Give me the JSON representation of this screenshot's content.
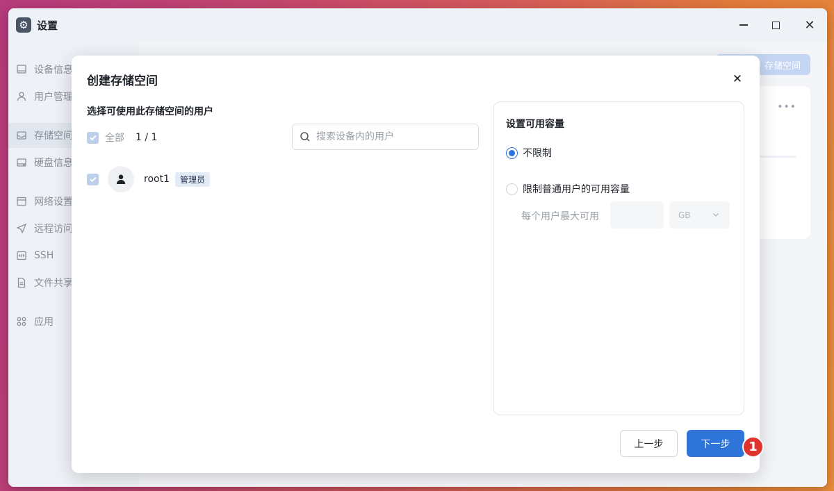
{
  "window": {
    "title": "设置"
  },
  "sidebar": {
    "items": [
      {
        "label": "设备信息"
      },
      {
        "label": "用户管理"
      },
      {
        "label": "存储空间"
      },
      {
        "label": "硬盘信息"
      },
      {
        "label": "网络设置"
      },
      {
        "label": "远程访问"
      },
      {
        "label": "SSH"
      },
      {
        "label": "文件共享"
      },
      {
        "label": "应用"
      }
    ]
  },
  "background": {
    "create_button_label": "存储空间"
  },
  "modal": {
    "title": "创建存储空间",
    "section_title": "选择可使用此存储空间的用户",
    "select_all_label": "全部",
    "selection_count": "1 / 1",
    "search_placeholder": "搜索设备内的用户",
    "users": [
      {
        "name": "root1",
        "role_badge": "管理员"
      }
    ],
    "capacity": {
      "title": "设置可用容量",
      "option_unlimited": "不限制",
      "option_limited": "限制普通用户的可用容量",
      "per_user_label": "每个用户最大可用",
      "unit": "GB"
    },
    "prev_button": "上一步",
    "next_button": "下一步"
  },
  "annotation": {
    "step_number": "1"
  },
  "colors": {
    "accent": "#2f74d9",
    "marker": "#e0332e"
  }
}
